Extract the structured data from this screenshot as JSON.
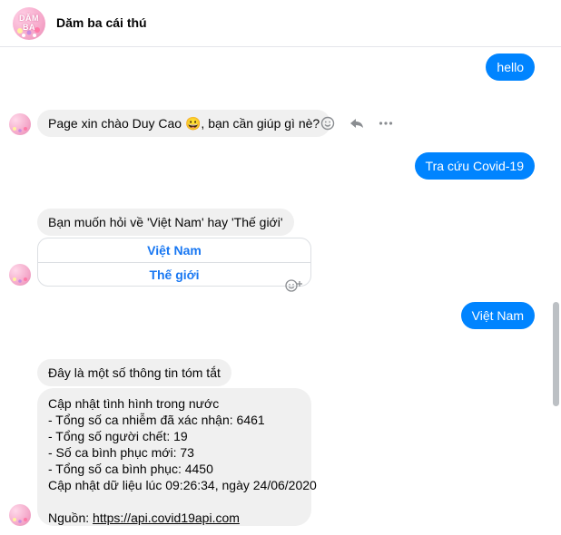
{
  "header": {
    "title": "Dăm ba cái thú",
    "avatar_text": "DĂM BA"
  },
  "messages": {
    "hello": "hello",
    "greeting": "Page xin chào Duy Cao 😀, bạn cần giúp gì nè?",
    "lookup": "Tra cứu Covid-19",
    "question": "Bạn muốn hỏi về 'Việt Nam' hay 'Thế giới'",
    "quick_replies": [
      "Việt Nam",
      "Thế giới"
    ],
    "vietnam": "Việt Nam",
    "summary_intro": "Đây là một số thông tin tóm tắt",
    "summary_lines": [
      "Cập nhật tình hình trong nước",
      "- Tổng số ca nhiễm đã xác nhận: 6461",
      "- Tổng số người chết: 19",
      "- Số ca bình phục mới: 73",
      "- Tổng số ca bình phục: 4450",
      "Cập nhật dữ liệu lúc 09:26:34, ngày 24/06/2020"
    ],
    "source_label": "Nguồn: ",
    "source_link": "https://api.covid19api.com"
  },
  "colors": {
    "outgoing": "#0084ff",
    "incoming": "#f0f0f0",
    "quick_reply_text": "#1877f2"
  }
}
